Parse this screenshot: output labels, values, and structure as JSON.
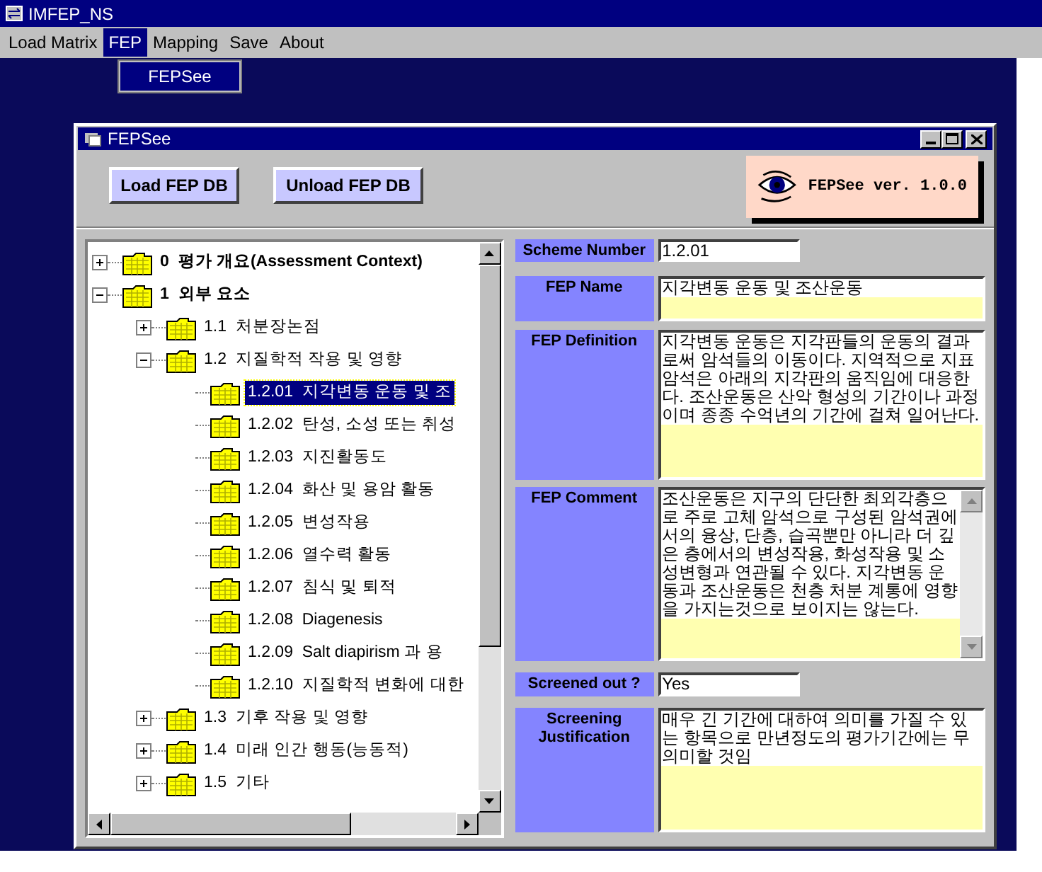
{
  "app_window": {
    "title": "IMFEP_NS"
  },
  "menu": [
    {
      "label": "Load Matrix",
      "selected": false
    },
    {
      "label": "FEP",
      "selected": true
    },
    {
      "label": "Mapping",
      "selected": false
    },
    {
      "label": "Save",
      "selected": false
    },
    {
      "label": "About",
      "selected": false
    }
  ],
  "submenu": [
    {
      "label": "FEPSee"
    }
  ],
  "fepsee_window": {
    "title": "FEPSee"
  },
  "toolbar_buttons": [
    "Load FEP DB",
    "Unload FEP DB"
  ],
  "logo": {
    "text": "FEPSee ver. 1.0.0"
  },
  "tree": [
    {
      "label": "0  평가 개요(Assessment Context)",
      "expanded": false,
      "selected": false
    },
    {
      "label": "1  외부 요소",
      "expanded": true,
      "selected": false,
      "children": [
        {
          "label": "1.1  처분장논점",
          "expanded": false,
          "selected": false
        },
        {
          "label": "1.2  지질학적 작용 및 영향",
          "expanded": true,
          "selected": false,
          "children": [
            {
              "label": "1.2.01  지각변동 운동 및 조",
              "selected": true
            },
            {
              "label": "1.2.02  탄성, 소성 또는 취성",
              "selected": false
            },
            {
              "label": "1.2.03  지진활동도",
              "selected": false
            },
            {
              "label": "1.2.04  화산 및 용암 활동",
              "selected": false
            },
            {
              "label": "1.2.05  변성작용",
              "selected": false
            },
            {
              "label": "1.2.06  열수력 활동",
              "selected": false
            },
            {
              "label": "1.2.07  침식 및 퇴적",
              "selected": false
            },
            {
              "label": "1.2.08  Diagenesis",
              "selected": false
            },
            {
              "label": "1.2.09  Salt diapirism 과 용",
              "selected": false
            },
            {
              "label": "1.2.10  지질학적 변화에 대한",
              "selected": false
            }
          ]
        },
        {
          "label": "1.3  기후 작용 및 영향",
          "expanded": false,
          "selected": false
        },
        {
          "label": "1.4  미래 인간 행동(능동적)",
          "expanded": false,
          "selected": false
        },
        {
          "label": "1.5  기타",
          "expanded": false,
          "selected": false
        }
      ]
    }
  ],
  "fields": [
    {
      "kind": "line",
      "label": "Scheme Number",
      "value": "1.2.01"
    },
    {
      "kind": "area",
      "label": "FEP Name",
      "value": "지각변동 운동 및 조산운동"
    },
    {
      "kind": "area",
      "label": "FEP Definition",
      "value": "지각변동 운동은 지각판들의 운동의 결과로써 암석들의 이동이다. 지역적으로 지표 암석은 아래의 지각판의 움직임에 대응한다. 조산운동은 산악 형성의 기간이나 과정이며 종종 수억년의 기간에 걸쳐 일어난다."
    },
    {
      "kind": "scroll-area",
      "label": "FEP Comment",
      "value": "조산운동은 지구의 단단한 최외각층으로 주로 고체 암석으로 구성된 암석권에서의 융상, 단층, 습곡뿐만 아니라 더 깊은 층에서의 변성작용, 화성작용 및 소성변형과 연관될 수 있다. 지각변동 운동과 조산운동은 천층 처분 계통에 영향을 가지는것으로 보이지는 않는다."
    },
    {
      "kind": "line",
      "label": "Screened out ?",
      "value": "Yes"
    },
    {
      "kind": "area",
      "label": "Screening Justification",
      "value": "매우 긴 기간에 대하여 의미를 가질 수 있는 항목으로 만년정도의 평가기간에는 무의미할 것임"
    }
  ]
}
